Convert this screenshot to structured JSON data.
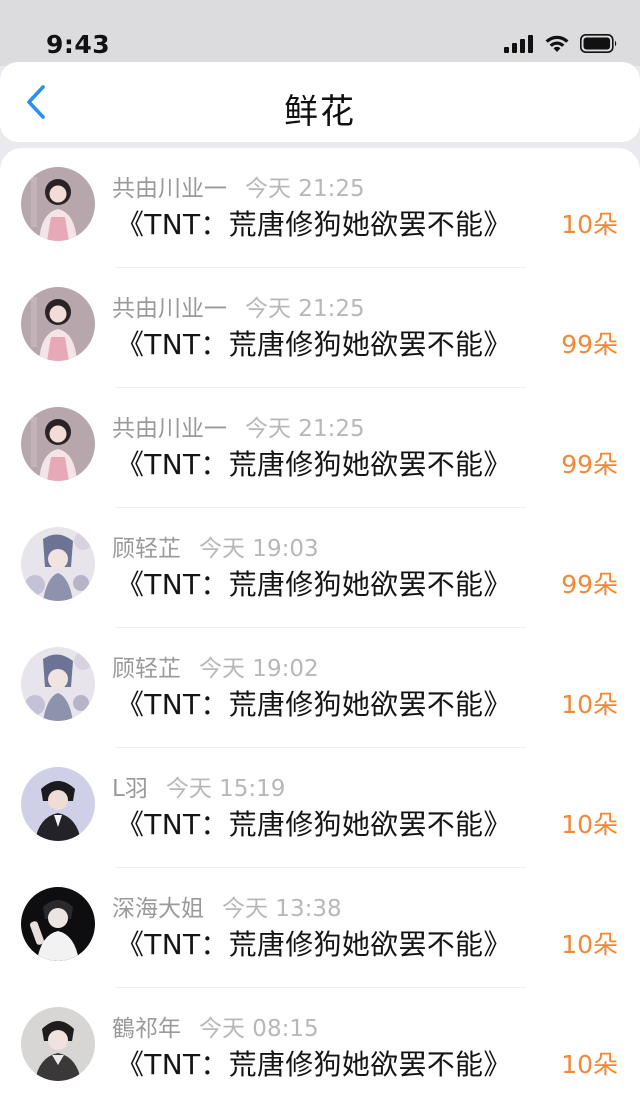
{
  "status_bar": {
    "time": "9:43",
    "icons": [
      "cellular-signal-icon",
      "wifi-icon",
      "battery-icon"
    ]
  },
  "header": {
    "title": "鲜花",
    "back_icon": "chevron-left-icon"
  },
  "colors": {
    "accent_blue": "#2a90f0",
    "count_orange": "#f0883a",
    "name_gray": "#9a9a9a",
    "title_black": "#151515"
  },
  "rows": [
    {
      "name": "共由川业一",
      "time": "今天 21:25",
      "title": "《TNT：荒唐修狗她欲罢不能》",
      "count": "10朵",
      "avatar": "avatar-girl-pink"
    },
    {
      "name": "共由川业一",
      "time": "今天 21:25",
      "title": "《TNT：荒唐修狗她欲罢不能》",
      "count": "99朵",
      "avatar": "avatar-girl-pink"
    },
    {
      "name": "共由川业一",
      "time": "今天 21:25",
      "title": "《TNT：荒唐修狗她欲罢不能》",
      "count": "99朵",
      "avatar": "avatar-girl-pink"
    },
    {
      "name": "顾轻芷",
      "time": "今天 19:03",
      "title": "《TNT：荒唐修狗她欲罢不能》",
      "count": "99朵",
      "avatar": "avatar-anime-flowers"
    },
    {
      "name": "顾轻芷",
      "time": "今天 19:02",
      "title": "《TNT：荒唐修狗她欲罢不能》",
      "count": "10朵",
      "avatar": "avatar-anime-flowers"
    },
    {
      "name": "L羽",
      "time": "今天 15:19",
      "title": "《TNT：荒唐修狗她欲罢不能》",
      "count": "10朵",
      "avatar": "avatar-man-dark"
    },
    {
      "name": "深海大姐",
      "time": "今天 13:38",
      "title": "《TNT：荒唐修狗她欲罢不能》",
      "count": "10朵",
      "avatar": "avatar-man-white-shirt"
    },
    {
      "name": "鶴祁年",
      "time": "今天 08:15",
      "title": "《TNT：荒唐修狗她欲罢不能》",
      "count": "10朵",
      "avatar": "avatar-man-suit"
    }
  ]
}
